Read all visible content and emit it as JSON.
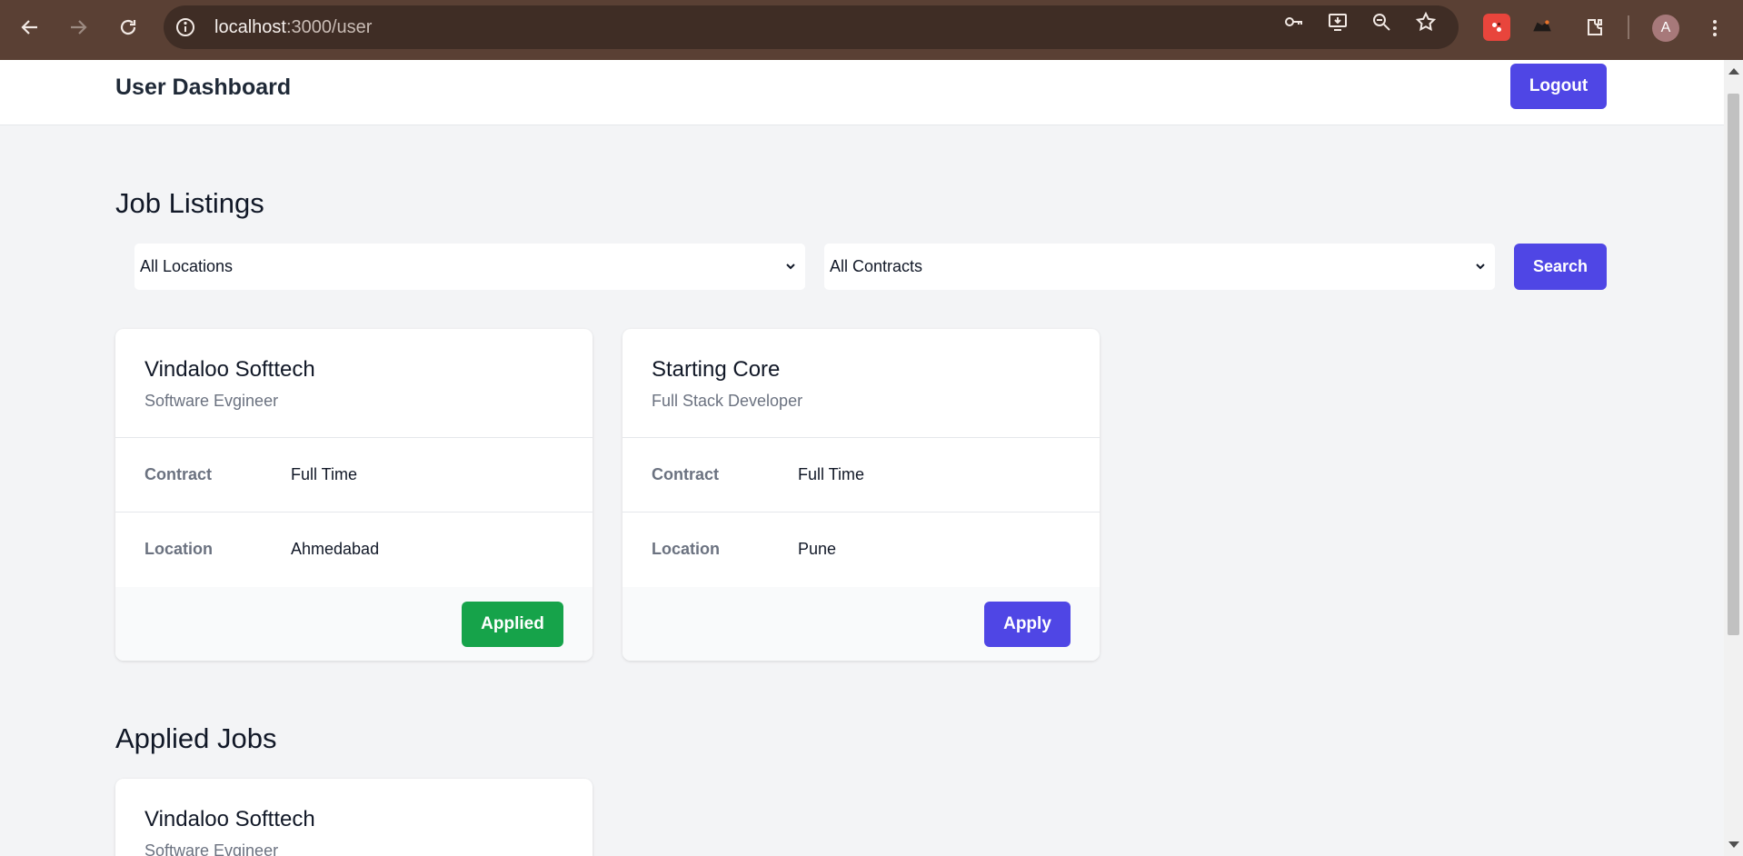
{
  "browser": {
    "url_host": "localhost",
    "url_path": ":3000/user",
    "avatar_letter": "A",
    "icons": [
      "back-arrow-icon",
      "forward-arrow-icon",
      "reload-icon",
      "site-info-icon",
      "password-key-icon",
      "install-app-icon",
      "zoom-out-icon",
      "bookmark-star-icon",
      "extension-icon",
      "menu-kebab-icon"
    ]
  },
  "header": {
    "title": "User Dashboard",
    "logout_label": "Logout"
  },
  "job_listings": {
    "heading": "Job Listings",
    "location_filter": "All Locations",
    "contract_filter": "All Contracts",
    "search_label": "Search",
    "cards": [
      {
        "company": "Vindaloo Softtech",
        "role": "Software Evgineer",
        "contract_label": "Contract",
        "contract": "Full Time",
        "location_label": "Location",
        "location": "Ahmedabad",
        "action": "Applied"
      },
      {
        "company": "Starting Core",
        "role": "Full Stack Developer",
        "contract_label": "Contract",
        "contract": "Full Time",
        "location_label": "Location",
        "location": "Pune",
        "action": "Apply"
      }
    ]
  },
  "applied_jobs": {
    "heading": "Applied Jobs",
    "cards": [
      {
        "company": "Vindaloo Softtech",
        "role": "Software Evgineer"
      }
    ]
  },
  "colors": {
    "primary": "#4f46e5",
    "success": "#16a34a",
    "chrome": "#5a4034"
  }
}
